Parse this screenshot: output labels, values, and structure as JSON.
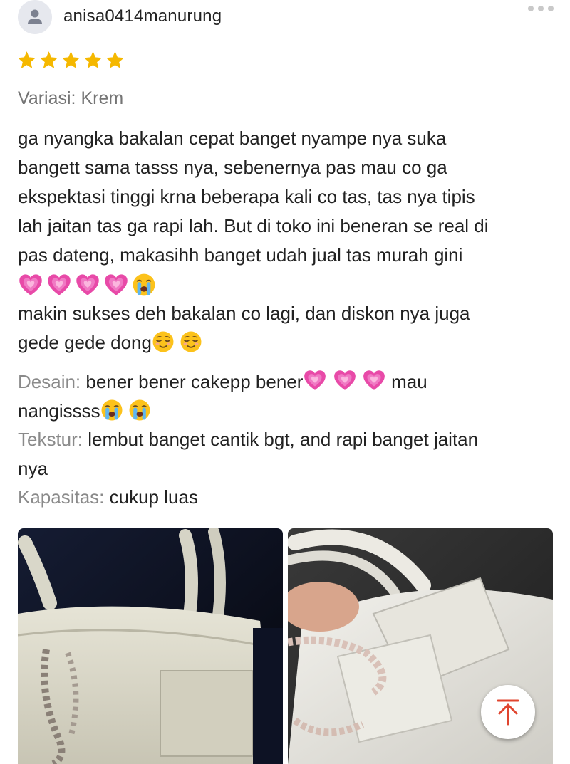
{
  "review": {
    "username": "anisa0414manurung",
    "rating": 5,
    "variant": "Variasi: Krem",
    "body_lines": [
      "ga nyangka bakalan cepat banget nyampe nya suka",
      "bangett sama tasss nya, sebenernya pas mau co ga",
      "ekspektasi tinggi krna beberapa kali co tas, tas nya tipis",
      "lah jaitan tas ga rapi lah. But di toko ini beneran se real di",
      "pas dateng, makasihh banget udah jual tas  murah gini"
    ],
    "body_lines_after": [
      "makin sukses deh bakalan co lagi, dan diskon nya juga"
    ],
    "body_last": "gede gede dong",
    "attributes": {
      "desain_key": "Desain:",
      "desain_val": "bener bener cakepp bener",
      "desain_tail": "mau",
      "desain_line2": "nangissss",
      "tekstur_key": "Tekstur:",
      "tekstur_val": "lembut banget cantik bgt, and rapi banget jaitan",
      "tekstur_line2": "nya",
      "kapasitas_key": "Kapasitas:",
      "kapasitas_val": "cukup luas"
    }
  },
  "icons": {
    "avatar": "user-avatar-icon",
    "more": "more-horizontal-icon",
    "star": "star-icon",
    "heart": "growing-heart-emoji",
    "cry": "loudly-crying-emoji",
    "relieved": "relieved-face-emoji",
    "scroll_top": "arrow-up-icon"
  },
  "colors": {
    "star": "#f5b800",
    "heart": "#e84aa8",
    "scroll_arrow": "#e0452f",
    "muted_text": "#8a8a8a"
  }
}
